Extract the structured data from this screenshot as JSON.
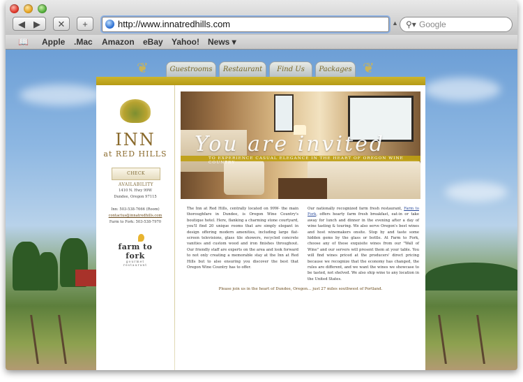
{
  "browser": {
    "url": "http://www.innatredhills.com",
    "search_placeholder": "Google",
    "nav_back": "◀",
    "nav_forward": "▶",
    "stop": "✕",
    "add": "+",
    "snapback": "▲",
    "bookmarks": [
      "Apple",
      ".Mac",
      "Amazon",
      "eBay",
      "Yahoo!",
      "News ▾"
    ],
    "bookmarks_icon": "book-icon"
  },
  "site": {
    "tabs": [
      "Guestrooms",
      "Restaurant",
      "Find Us",
      "Packages"
    ],
    "logo": {
      "name": "INN",
      "sub": "at RED HILLS"
    },
    "check_availability": "CHECK AVAILABILITY",
    "address_line1": "1410 N. Hwy 99W",
    "address_line2": "Dundee, Oregon 97115",
    "phone_inn": "Inn: 503-538-7666 (Room)",
    "email": "contactus@innatredhills.com",
    "phone_ftf": "Farm to Fork: 503-538-7970",
    "ftf_logo": "farm to fork",
    "ftf_sub": "gourmet restaurant",
    "hero_script": "You are invited",
    "hero_tagline": "TO EXPERIENCE CASUAL ELEGANCE IN THE HEART OF OREGON WINE COUNTRY",
    "para1": "The Inn at Red Hills, centrally located on 99W- the main thoroughfare in Dundee, is Oregon Wine Country's boutique hotel. Here, flanking a charming stone courtyard, you'll find 20 unique rooms that are simply elegant in design offering modern amenities, including large flat-screen televisions, glass tile showers, recycled concrete vanities and custom wood and iron finishes throughout. Our friendly staff are experts on the area and look forward to not only creating a memorable stay at the Inn at Red Hills but to also ensuring you discover the best that Oregon Wine Country has to offer.",
    "para2_pre": "Our nationally recognized farm fresh restaurant,",
    "para2_link": "Farm to Fork",
    "para2_post": ", offers hearty farm fresh breakfast, eat-in or take away for lunch and dinner in the evening after a day of wine tasting & touring. We also serve Oregon's best wines and host winemakers onsite. Stop by and taste some hidden gems by the glass or bottle. At Farm to Fork, choose any of these exquisite wines from our \"Wall of Wine\" and our servers will present them at your table. You will find wines priced at the producers' direct pricing because we recognize that the economy has changed, the rules are different, and we want the wines we showcase to be tasted, not shelved. We also ship wine to any location in the United States.",
    "closing": "Please join us in the heart of Dundee, Oregon… just 27 miles southwest of Portland."
  },
  "colors": {
    "gold": "#b59a16",
    "brown_text": "#8a6a2c",
    "link_blue": "#2a4a9a"
  }
}
